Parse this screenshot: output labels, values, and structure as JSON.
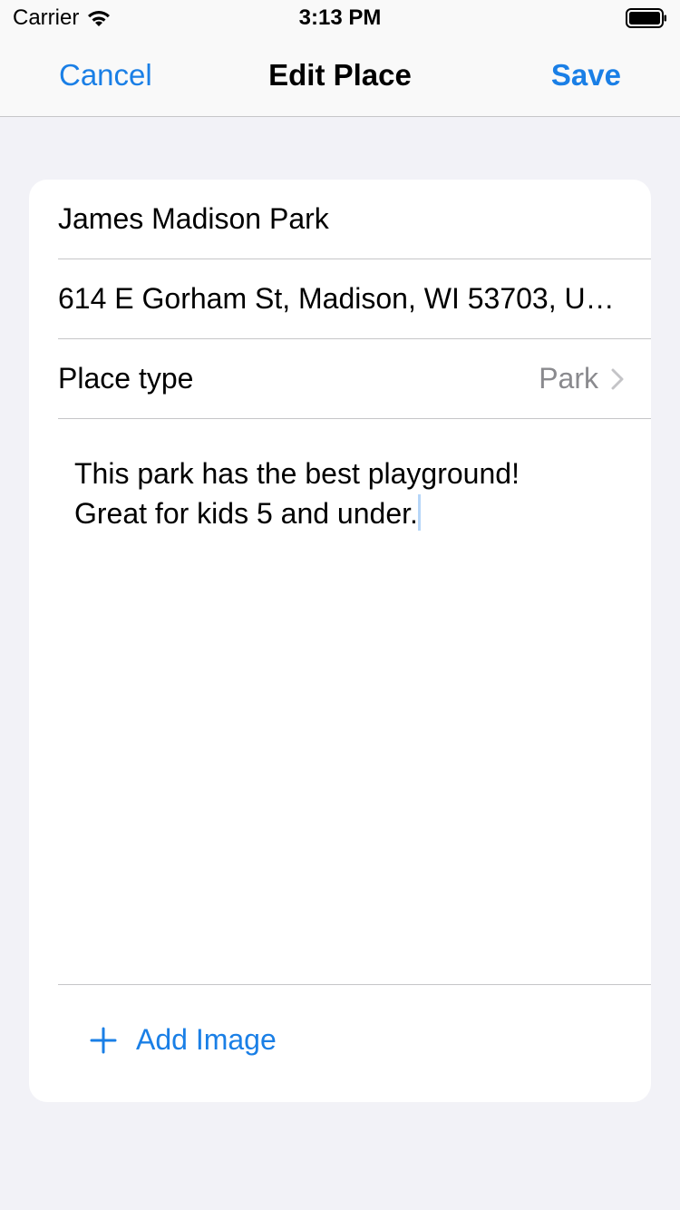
{
  "status_bar": {
    "carrier": "Carrier",
    "time": "3:13 PM",
    "icons": [
      "wifi-icon",
      "battery-icon"
    ]
  },
  "nav": {
    "cancel_label": "Cancel",
    "title": "Edit Place",
    "save_label": "Save",
    "accent_color": "#1a7fe6"
  },
  "form": {
    "name_value": "James Madison Park",
    "address_value": "614 E Gorham St, Madison, WI  53703, United States",
    "place_type_label": "Place type",
    "place_type_value": "Park",
    "notes_line1": "This park has the best playground!",
    "notes_line2": "Great for kids 5 and under.",
    "add_image_label": "Add Image"
  }
}
